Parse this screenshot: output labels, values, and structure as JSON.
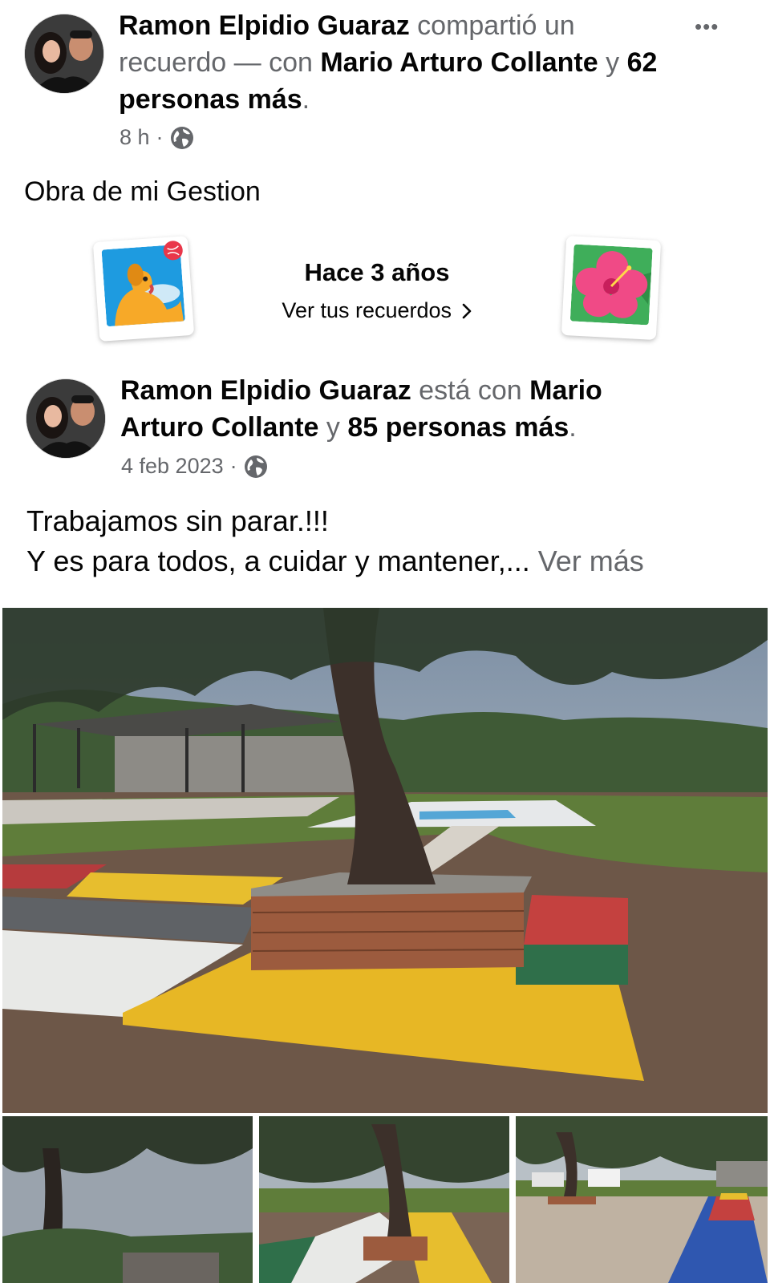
{
  "share_post": {
    "author": "Ramon Elpidio Guaraz",
    "action": " compartió un recuerdo — con ",
    "tagged": "Mario Arturo Collante",
    "connector": " y ",
    "others": "62 personas más",
    "period": ".",
    "time": "8 h",
    "dot": "·",
    "audience_icon": "globe-icon",
    "menu_icon": "more-options-icon",
    "menu_glyph": "•••",
    "text": "Obra de mi Gestion"
  },
  "memory_banner": {
    "title": "Hace 3 años",
    "link": "Ver tus recuerdos",
    "link_icon": "chevron-right-icon",
    "left_sticker": "dog-photo-sticker",
    "right_sticker": "hibiscus-photo-sticker"
  },
  "memory_post": {
    "author": "Ramon Elpidio Guaraz",
    "action": " está con ",
    "tagged": "Mario Arturo Collante",
    "connector": " y ",
    "others": "85 personas más",
    "period": ".",
    "time": "4 feb 2023",
    "dot": "·",
    "audience_icon": "globe-icon",
    "text_line1": "Trabajamos sin parar.!!!",
    "text_line2": "Y es para todos, a cuidar y mantener,...",
    "see_more": "Ver más"
  },
  "colors": {
    "text_primary": "#050505",
    "text_secondary": "#65676b"
  }
}
